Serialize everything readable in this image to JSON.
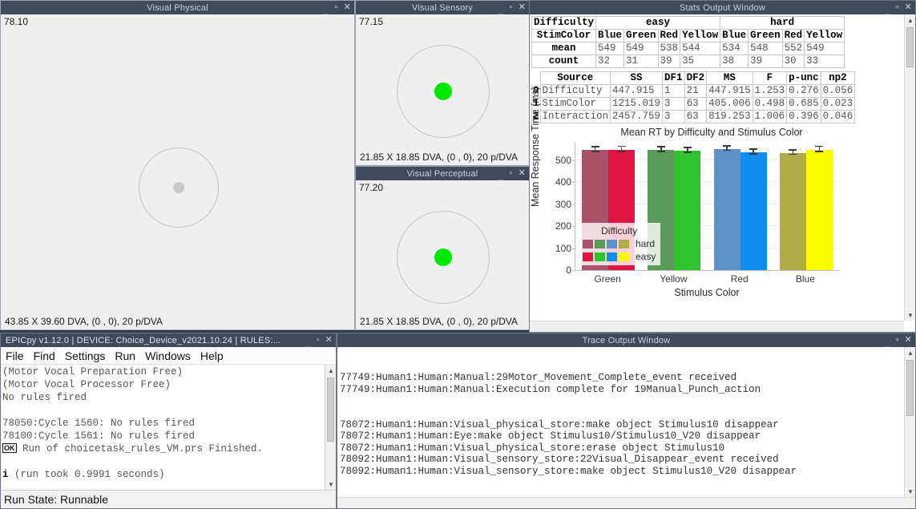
{
  "windows": {
    "visual_physical": {
      "title": "Visual Physical",
      "timestamp": "78.10",
      "footer": "43.85 X 39.60 DVA, (0 , 0), 20 p/DVA",
      "dot_color": "#c9c9c9"
    },
    "visual_sensory": {
      "title": "Visual Sensory",
      "timestamp": "77.15",
      "footer": "21.85 X 18.85 DVA, (0 , 0), 20 p/DVA",
      "dot_color": "#00e800"
    },
    "visual_perceptual": {
      "title": "Visual Perceptual",
      "timestamp": "77.20",
      "footer": "21.85 X 18.85 DVA, (0 , 0), 20 p/DVA",
      "dot_color": "#00e800"
    },
    "stats": {
      "title": "Stats Output Window"
    },
    "trace": {
      "title": "Trace Output Window"
    },
    "epicpy": {
      "title": "EPICpy v1.12.0 | DEVICE: Choice_Device_v2021.10.24 | RULES:...",
      "menus": [
        "File",
        "Find",
        "Settings",
        "Run",
        "Windows",
        "Help"
      ],
      "status": "Run State: Runnable"
    }
  },
  "window_controls": {
    "minimize": "_",
    "maximize": "▫",
    "close": "✕"
  },
  "stats": {
    "pivot": {
      "row_label_difficulty": "Difficulty",
      "row_label_stimcolor": "StimColor",
      "difficulty_groups": [
        {
          "label": "easy",
          "span": 4
        },
        {
          "label": "hard",
          "span": 4
        }
      ],
      "stim_colors": [
        "Blue",
        "Green",
        "Red",
        "Yellow",
        "Blue",
        "Green",
        "Red",
        "Yellow"
      ],
      "rows": [
        {
          "label": "mean",
          "values": [
            "549",
            "549",
            "538",
            "544",
            "534",
            "548",
            "552",
            "549"
          ]
        },
        {
          "label": "count",
          "values": [
            "32",
            "31",
            "39",
            "35",
            "38",
            "39",
            "30",
            "33"
          ]
        }
      ]
    },
    "anova": {
      "headers": [
        "",
        "Source",
        "SS",
        "DF1",
        "DF2",
        "MS",
        "F",
        "p-unc",
        "np2"
      ],
      "rows": [
        {
          "idx": "0",
          "cells": [
            "Difficulty",
            "447.915",
            "1",
            "21",
            "447.915",
            "1.253",
            "0.276",
            "0.056"
          ]
        },
        {
          "idx": "1",
          "cells": [
            "StimColor",
            "1215.019",
            "3",
            "63",
            "405.006",
            "0.498",
            "0.685",
            "0.023"
          ]
        },
        {
          "idx": "2",
          "cells": [
            "Interaction",
            "2457.759",
            "3",
            "63",
            "819.253",
            "1.006",
            "0.396",
            "0.046"
          ]
        }
      ]
    }
  },
  "chart_data": {
    "type": "bar",
    "title": "Mean RT by Difficulty and Stimulus Color",
    "xlabel": "Stimulus Color",
    "ylabel": "Mean Response Time (ms)",
    "categories": [
      "Green",
      "Yellow",
      "Red",
      "Blue"
    ],
    "ylim": [
      0,
      580
    ],
    "yticks": [
      0,
      100,
      200,
      300,
      400,
      500
    ],
    "grid": true,
    "legend_title": "Difficulty",
    "legend_position": "lower left",
    "series": [
      {
        "name": "hard",
        "values": [
          548,
          548,
          552,
          534
        ],
        "errors": [
          11,
          11,
          10,
          10
        ],
        "colors": [
          "#a9526a",
          "#5a9a5a",
          "#5f92c8",
          "#b0ac45"
        ]
      },
      {
        "name": "easy",
        "values": [
          549,
          544,
          538,
          549
        ],
        "errors": [
          11,
          11,
          11,
          12
        ],
        "colors": [
          "#e01440",
          "#2ec22e",
          "#118df0",
          "#fbfb00"
        ]
      }
    ],
    "legend_swatches": {
      "hard": [
        "#a9526a",
        "#5a9a5a",
        "#5f92c8",
        "#b0ac45"
      ],
      "easy": [
        "#e01440",
        "#2ec22e",
        "#118df0",
        "#fbfb00"
      ]
    }
  },
  "epicpy_console": {
    "lines": [
      {
        "text": "(Motor Vocal Preparation Free)",
        "style": "plain"
      },
      {
        "text": "(Motor Vocal Processor Free)",
        "style": "plain"
      },
      {
        "text": "No rules fired",
        "style": "plain"
      },
      {
        "text": "",
        "style": "plain"
      },
      {
        "text": "78050:Cycle 1560: No rules fired",
        "style": "plain"
      },
      {
        "text": "78100:Cycle 1561: No rules fired",
        "style": "plain"
      },
      {
        "text": "Run of choicetask_rules_VM.prs Finished.",
        "style": "ok"
      },
      {
        "text": "",
        "style": "plain"
      },
      {
        "text": "(run took 0.9991 seconds)",
        "style": "info"
      }
    ],
    "ok_tag": "OK",
    "info_tag": "i"
  },
  "trace_output": {
    "lines": [
      "",
      "",
      "77749:Human1:Human:Manual:29Motor_Movement_Complete_event received",
      "77749:Human1:Human:Manual:Execution complete for 19Manual_Punch_action",
      "",
      "",
      "78072:Human1:Human:Visual_physical_store:make object Stimulus10 disappear",
      "78072:Human1:Human:Eye:make object Stimulus10/Stimulus10_V20 disappear",
      "78072:Human1:Human:Visual_physical_store:erase object Stimulus10",
      "78092:Human1:Human:Visual_sensory_store:22Visual_Disappear_event received",
      "78092:Human1:Human:Visual_sensory_store:make object Stimulus10_V20 disappear"
    ]
  }
}
